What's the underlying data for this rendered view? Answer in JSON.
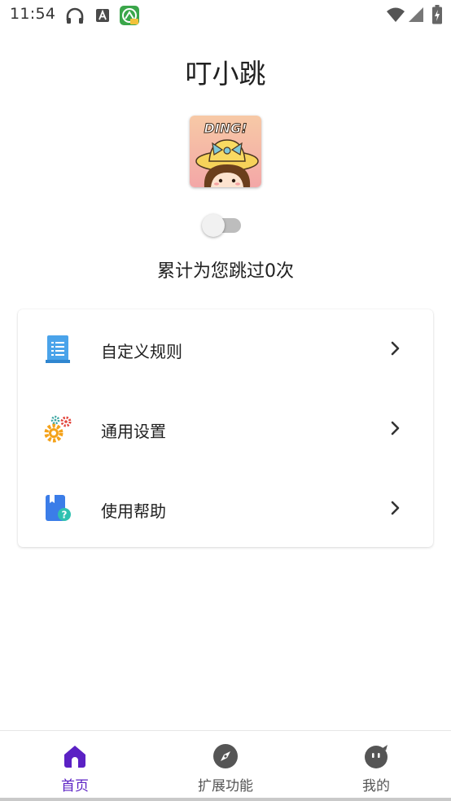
{
  "status_bar": {
    "time": "11:54",
    "icons": [
      "headphones-icon",
      "a-notification-icon",
      "app-notification-icon",
      "wifi-icon",
      "signal-icon",
      "battery-icon"
    ]
  },
  "app": {
    "title": "叮小跳",
    "logo_text": "DING!",
    "service_enabled": false,
    "skip_count_text": "累计为您跳过0次"
  },
  "menu": {
    "items": [
      {
        "label": "自定义规则",
        "icon": "document-list-icon"
      },
      {
        "label": "通用设置",
        "icon": "gears-icon"
      },
      {
        "label": "使用帮助",
        "icon": "help-book-icon"
      }
    ]
  },
  "bottom_nav": {
    "items": [
      {
        "label": "首页",
        "icon": "home-icon",
        "active": true
      },
      {
        "label": "扩展功能",
        "icon": "compass-icon",
        "active": false
      },
      {
        "label": "我的",
        "icon": "profile-face-icon",
        "active": false
      }
    ]
  },
  "colors": {
    "accent": "#5b21c4",
    "nav_inactive": "#555555",
    "switch_track_off": "#bdbdbd"
  }
}
